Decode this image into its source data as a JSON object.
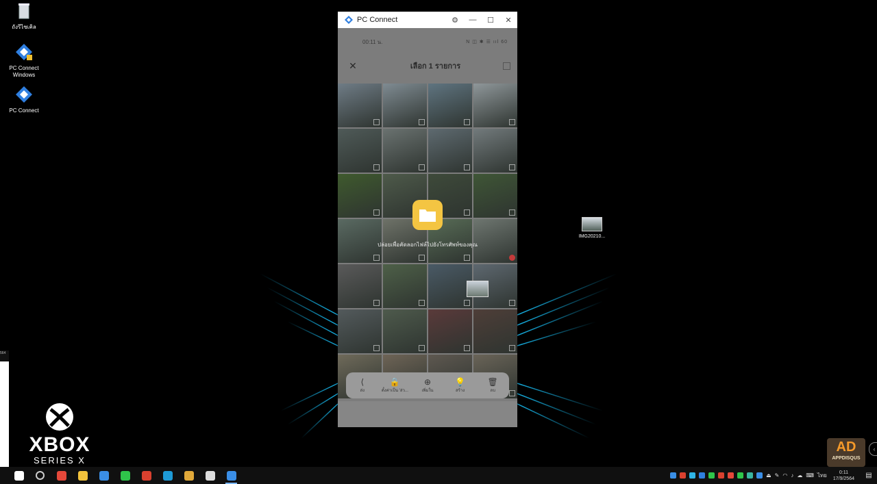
{
  "desktop": {
    "icons": [
      {
        "label": "ถังรีไซเคิล"
      },
      {
        "label": "PC Connect Windows"
      },
      {
        "label": "PC Connect"
      }
    ],
    "dragged_file": {
      "label": "IMG20210..."
    },
    "branding": {
      "word": "XBOX",
      "series": "SERIES X"
    },
    "left_tag": "564",
    "watermark": {
      "big": "AD",
      "small": "APPDISQUS"
    }
  },
  "window": {
    "title": "PC Connect",
    "controls": {
      "settings": "⚙",
      "minimize": "—",
      "maximize": "☐",
      "close": "✕"
    }
  },
  "phone": {
    "status": {
      "time": "00:11 น.",
      "icons": "N ◫ ✱ ☰ ııl 60"
    },
    "header": {
      "close": "✕",
      "title": "เลือก 1 รายการ"
    },
    "drop_hint": "ปล่อยเพื่อคัดลอกไฟล์ไปยังโทรศัพท์ของคุณ",
    "actions": [
      {
        "icon": "share-icon",
        "glyph": "⟨",
        "label": "ส่ง"
      },
      {
        "icon": "lock-icon",
        "glyph": "🔒",
        "label": "ตั้งค่าเป็น 'ส่ว..."
      },
      {
        "icon": "add-to-icon",
        "glyph": "⊕",
        "label": "เพิ่มใน"
      },
      {
        "icon": "create-icon",
        "glyph": "💡",
        "label": "สร้าง"
      },
      {
        "icon": "delete-icon",
        "glyph": "🗑",
        "label": "ลบ"
      }
    ],
    "photos": [
      "#6f7c86",
      "#7f8b92",
      "#5f7480",
      "#8f979a",
      "#4f5a58",
      "#6a7270",
      "#5e6a70",
      "#727a7c",
      "#3f5a2e",
      "#4e5a4a",
      "#3e4a3a",
      "#3f5636",
      "#5a6a62",
      "#6e7268",
      "#586c56",
      "#6e7670",
      "#5a5a5a",
      "#4e6048",
      "#4a5a66",
      "#5e6870",
      "#535a5c",
      "#4e5a4c",
      "#5a3a3a",
      "#4e3e38",
      "#6f6a5a",
      "#6e6456",
      "#5e5850",
      "#6a6458"
    ],
    "selected_index": 15
  },
  "taskbar": {
    "apps": [
      {
        "name": "start",
        "color": "#ffffff"
      },
      {
        "name": "search",
        "color": "#cccccc"
      },
      {
        "name": "app-1",
        "color": "#e5483a"
      },
      {
        "name": "file-explorer",
        "color": "#f3c33c"
      },
      {
        "name": "calendar",
        "color": "#3a8ee6"
      },
      {
        "name": "line",
        "color": "#2fc54a"
      },
      {
        "name": "app-red",
        "color": "#d9412f"
      },
      {
        "name": "edge",
        "color": "#1e9ad6"
      },
      {
        "name": "chrome",
        "color": "#e1a93a"
      },
      {
        "name": "app-wave",
        "color": "#dddddd"
      },
      {
        "name": "pc-connect",
        "color": "#3a8ee6"
      }
    ],
    "tray": {
      "lang": "ไทย",
      "time": "0:11",
      "date": "17/9/2564"
    }
  },
  "colors": {
    "accent": "#3a8ee6",
    "folder": "#f4c542",
    "glow": "#19c6ff"
  }
}
